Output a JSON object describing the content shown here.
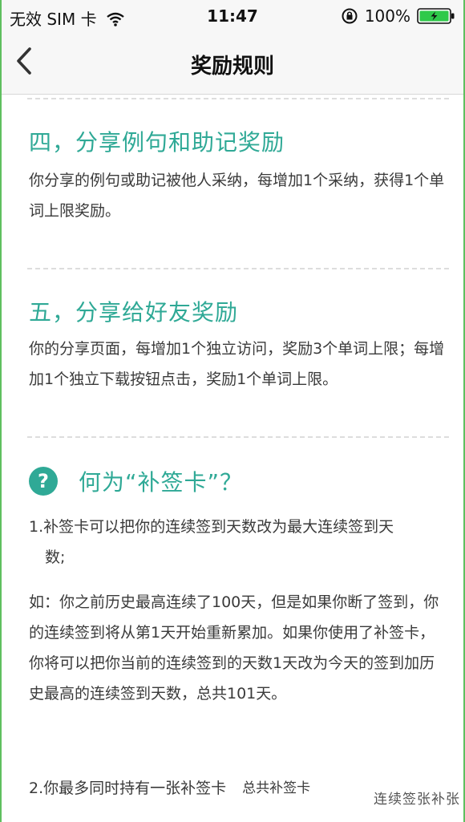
{
  "status_bar": {
    "carrier": "无效 SIM 卡",
    "time": "11:47",
    "battery": "100%"
  },
  "nav": {
    "title": "奖励规则"
  },
  "section4": {
    "heading": "四，分享例句和助记奖励",
    "body": "你分享的例句或助记被他人采纳，每增加1个采纳，获得1个单词上限奖励。"
  },
  "section5": {
    "heading": "五，分享给好友奖励",
    "body": "你的分享页面，每增加1个独立访问，奖励3个单词上限；每增加1个独立下载按钮点击，奖励1个单词上限。"
  },
  "faq": {
    "icon_glyph": "?",
    "title": "何为“补签卡”？",
    "item1_line1": "1.补签卡可以把你的连续签到天数改为最大连续签到天",
    "item1_line2": "数;",
    "example": "如：你之前历史最高连续了100天，但是如果你断了签到，你的连续签到将从第1天开始重新累加。如果你使用了补签卡，你将可以把你当前的连续签到的天数1天改为今天的签到加历史最高的连续签到天数，总共101天。",
    "item2": "2.你最多同时持有一张补签卡",
    "item2_extra": "总共补签卡",
    "overlay": "连续签张补张"
  },
  "colors": {
    "accent": "#2fa996",
    "divider": "#dddddd",
    "bar_bg": "#f7f7f7",
    "frame": "#5fbf5f",
    "battery_fill": "#2ec94a"
  },
  "icons": {
    "back": "chevron-left-icon",
    "wifi": "wifi-icon",
    "lock": "orientation-lock-icon",
    "battery": "battery-icon",
    "question": "question-icon"
  }
}
